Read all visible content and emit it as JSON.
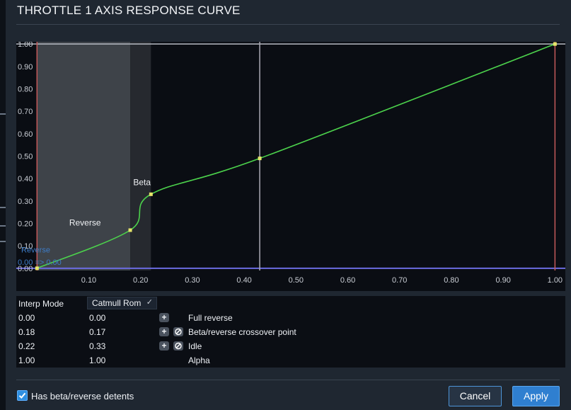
{
  "dialog": {
    "title": "THROTTLE 1 AXIS RESPONSE CURVE"
  },
  "chart_data": {
    "type": "line",
    "xlim": [
      -0.04,
      1.02
    ],
    "ylim": [
      -0.01,
      1.01
    ],
    "y_ticks": [
      "0.00",
      "0.10",
      "0.20",
      "0.30",
      "0.40",
      "0.50",
      "0.60",
      "0.70",
      "0.80",
      "0.90",
      "1.00"
    ],
    "x_ticks": [
      "0.10",
      "0.20",
      "0.30",
      "0.40",
      "0.50",
      "0.60",
      "0.70",
      "0.80",
      "0.90",
      "1.00"
    ],
    "curve_points": [
      {
        "x": 0.0,
        "y": 0.0
      },
      {
        "x": 0.18,
        "y": 0.17
      },
      {
        "x": 0.22,
        "y": 0.33
      },
      {
        "x": 0.43,
        "y": 0.49
      },
      {
        "x": 1.0,
        "y": 1.0
      }
    ],
    "zones": [
      {
        "name": "Reverse",
        "from": 0.0,
        "to": 0.18,
        "color": "#3e4349"
      },
      {
        "name": "Beta",
        "from": 0.18,
        "to": 0.22,
        "color": "#26292f"
      }
    ],
    "cursor_x": 0.43,
    "annotations": [
      "Reverse",
      "Beta"
    ],
    "readout": {
      "label": "Reverse",
      "value": "0.00 => 0.00"
    },
    "colors": {
      "background": "#0a0d13",
      "curve": "#4cd24c",
      "point": "#e5e56a",
      "boundary": "#c45a5a",
      "baseline": "#6b6be0",
      "topline": "#b8bcc4",
      "cursor": "#aaaab4",
      "tick_text": "#c9cdd4",
      "readout_text": "#3d7cc7"
    }
  },
  "table": {
    "interp_label": "Interp Mode",
    "interp_value": "Catmull Rom",
    "rows": [
      {
        "x": "0.00",
        "y": "0.00",
        "label": "Full reverse",
        "add": true,
        "block": false
      },
      {
        "x": "0.18",
        "y": "0.17",
        "label": "Beta/reverse crossover point",
        "add": true,
        "block": true
      },
      {
        "x": "0.22",
        "y": "0.33",
        "label": "Idle",
        "add": true,
        "block": true
      },
      {
        "x": "1.00",
        "y": "1.00",
        "label": "Alpha",
        "add": false,
        "block": false
      }
    ]
  },
  "footer": {
    "checkbox_label": "Has beta/reverse detents",
    "checkbox_checked": true,
    "cancel_label": "Cancel",
    "apply_label": "Apply"
  }
}
